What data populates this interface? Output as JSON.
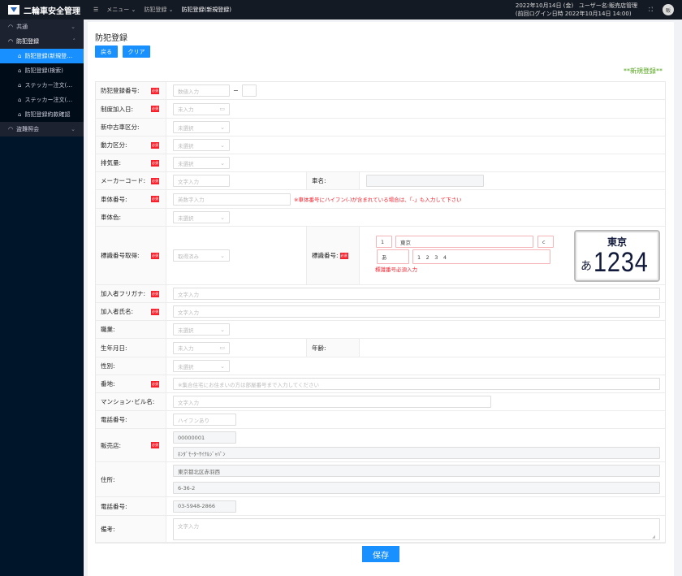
{
  "app": {
    "title": "二輪車安全管理"
  },
  "header": {
    "menu_icon": "menu-icon",
    "breadcrumb": [
      "メニュー",
      "防犯登録",
      "防犯登録(新規登録)"
    ],
    "date": "2022年10月14日 (金)",
    "user": "ユーザー名:販売店管理",
    "last_login": "(前回ログイン日時 2022年10月14日 14:00)",
    "avatar": "販"
  },
  "sidebar": {
    "groups": [
      {
        "label": "共通",
        "expanded": false
      },
      {
        "label": "防犯登録",
        "expanded": true,
        "items": [
          "防犯登録(新規登…",
          "防犯登録(検索)",
          "ステッカー注文(…",
          "ステッカー注文(…",
          "防犯登録約款確認"
        ]
      },
      {
        "label": "盗難照会",
        "expanded": false
      }
    ]
  },
  "page": {
    "title": "防犯登録",
    "back": "戻る",
    "clear": "クリア",
    "mode": "**新規登録**",
    "save": "保存",
    "required": "必須",
    "accent": "#1890ff"
  },
  "form": {
    "reg_no": {
      "label": "防犯登録番号:",
      "placeholder": "数値入力",
      "dash": "−"
    },
    "join_date": {
      "label": "制度加入日:",
      "placeholder": "未入力"
    },
    "new_used": {
      "label": "新中古車区分:",
      "placeholder": "未選択"
    },
    "power": {
      "label": "動力区分:",
      "placeholder": "未選択"
    },
    "displacement": {
      "label": "排気量:",
      "placeholder": "未選択"
    },
    "maker": {
      "label": "メーカーコード:",
      "placeholder": "文字入力",
      "name_label": "車名:"
    },
    "frame_no": {
      "label": "車体番号:",
      "placeholder": "英数字入力",
      "note": "※車体番号にハイフン(-)が含まれている場合は、「-」も入力して下さい"
    },
    "color": {
      "label": "車体色:",
      "placeholder": "未選択"
    },
    "plate_obtained": {
      "label": "標識番号取得:",
      "value": "取得済み"
    },
    "plate": {
      "label": "標識番号:",
      "class": "1",
      "region": "東京",
      "c": "c",
      "kana": "あ",
      "number": "1　2　3　4",
      "error": "標識番号必須入力",
      "preview_region": "東京",
      "preview_kana": "あ",
      "preview_number": "1234"
    },
    "furigana": {
      "label": "加入者フリガナ:",
      "placeholder": "文字入力"
    },
    "name": {
      "label": "加入者氏名:",
      "placeholder": "文字入力"
    },
    "job": {
      "label": "職業:",
      "placeholder": "未選択"
    },
    "birth": {
      "label": "生年月日:",
      "placeholder": "未入力",
      "age_label": "年齢:"
    },
    "gender": {
      "label": "性別:",
      "placeholder": "未選択"
    },
    "address": {
      "label": "番地:",
      "placeholder": "※集合住宅にお住まいの方は部屋番号まで入力してください"
    },
    "building": {
      "label": "マンション･ビル名:",
      "placeholder": "文字入力"
    },
    "phone": {
      "label": "電話番号:",
      "placeholder": "ハイフンあり"
    },
    "shop": {
      "label": "販売店:",
      "code": "00000001",
      "name": "ﾎﾝﾀﾞﾓｰﾀｰｻｲｸﾙｼﾞｬﾊﾟﾝ"
    },
    "shop_address": {
      "label": "住所:",
      "line1": "東京都北区赤羽西",
      "line2": "6-36-2"
    },
    "shop_phone": {
      "label": "電話番号:",
      "value": "03-5948-2866"
    },
    "remarks": {
      "label": "備考:",
      "placeholder": "文字入力"
    }
  }
}
